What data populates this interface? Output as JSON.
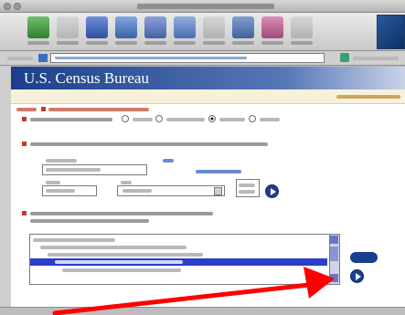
{
  "banner": {
    "title": "U.S. Census Bureau"
  },
  "colors": {
    "banner": "#1b3f8a",
    "accent_red": "#c43a2a",
    "go_button": "#1a3f8f",
    "annotation_arrow": "#ff0000"
  },
  "icons": [
    "back-icon",
    "forward-icon",
    "reload-icon",
    "home-icon",
    "search-icon",
    "netscape-icon",
    "images-icon",
    "print-icon",
    "security-icon",
    "stop-icon"
  ]
}
